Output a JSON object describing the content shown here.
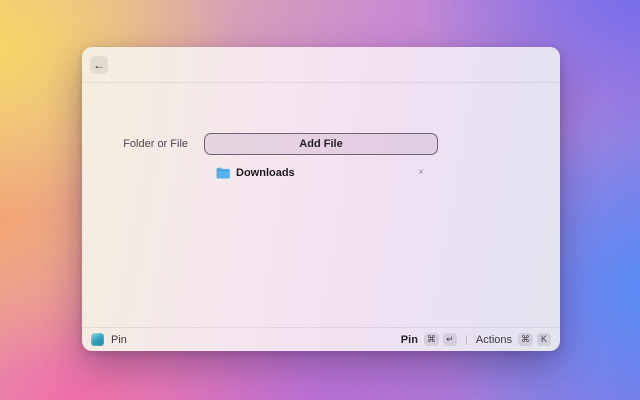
{
  "window": {
    "back_icon": "←",
    "form": {
      "label": "Folder or File",
      "add_file_button": "Add File",
      "files": [
        {
          "name": "Downloads",
          "icon": "folder-icon",
          "remove_icon": "×"
        }
      ]
    },
    "footer": {
      "app_label": "Pin",
      "pin_action_label": "Pin",
      "pin_keys": [
        "⌘",
        "↵"
      ],
      "actions_label": "Actions",
      "actions_keys": [
        "⌘",
        "K"
      ]
    }
  },
  "colors": {
    "folder_blue": "#58b0ea",
    "app_icon_teal": "#35a8c0",
    "window_tint_left": "#f4eedd",
    "window_tint_right": "#e2e4ee"
  }
}
